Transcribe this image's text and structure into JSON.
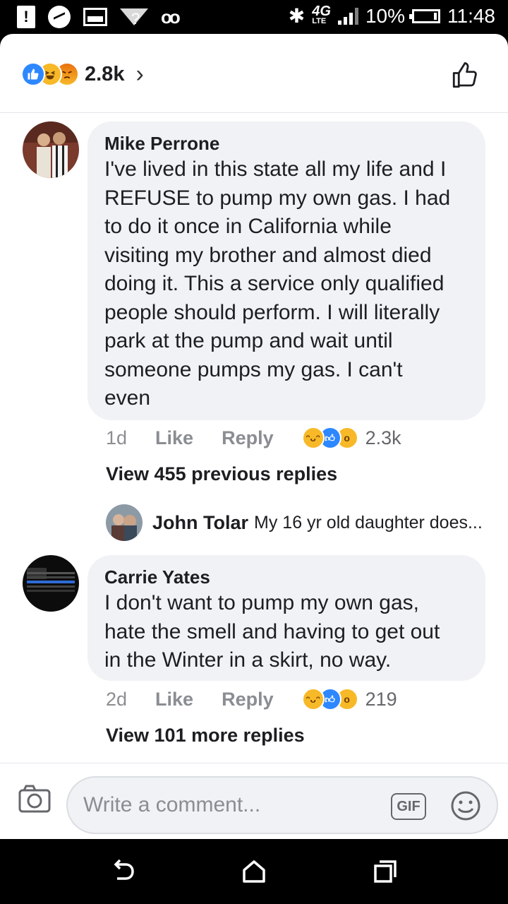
{
  "status_bar": {
    "alert_glyph": "!",
    "wifi_question": "?",
    "voicemail": "oo",
    "network": "4G",
    "network_sub": "LTE",
    "battery": "10%",
    "time": "11:48",
    "icons": [
      "alert-icon",
      "messenger-icon",
      "screenshot-icon",
      "wifi-icon",
      "voicemail-icon",
      "bluetooth-icon",
      "signal-icon",
      "battery-icon"
    ]
  },
  "header": {
    "reaction_count": "2.8k",
    "chevron": "›",
    "icons": [
      "like-reaction-icon",
      "haha-reaction-icon",
      "angry-reaction-icon",
      "thumbs-up-icon"
    ]
  },
  "comments": [
    {
      "name": "Mike Perrone",
      "lines": [
        "I've lived in this state all my life and I",
        "REFUSE to pump my own gas. I had",
        "to do it once in California while",
        "visiting my brother and almost died",
        "doing it. This a service only qualified",
        "people should perform. I will literally",
        "park at the pump and wait until",
        "someone pumps my gas. I can't",
        "even"
      ],
      "time": "1d",
      "like_label": "Like",
      "reply_label": "Reply",
      "reaction_count": "2.3k",
      "view_replies": "View 455 previous replies",
      "reply_preview": {
        "name": "John Tolar",
        "text": "My 16 yr old daughter does..."
      }
    },
    {
      "name": "Carrie Yates",
      "lines": [
        "I don't want to pump my own gas,",
        "hate the smell and having to get out",
        "in the Winter in a skirt, no way."
      ],
      "time": "2d",
      "like_label": "Like",
      "reply_label": "Reply",
      "reaction_count": "219",
      "view_replies": "View 101 more replies"
    }
  ],
  "composer": {
    "placeholder": "Write a comment...",
    "gif_label": "GIF"
  },
  "colors": {
    "accent": "#2d88ff",
    "bubble": "#f0f2f5",
    "haha": "#f7b928",
    "text": "#1c1e21",
    "muted": "#8a8d91"
  }
}
